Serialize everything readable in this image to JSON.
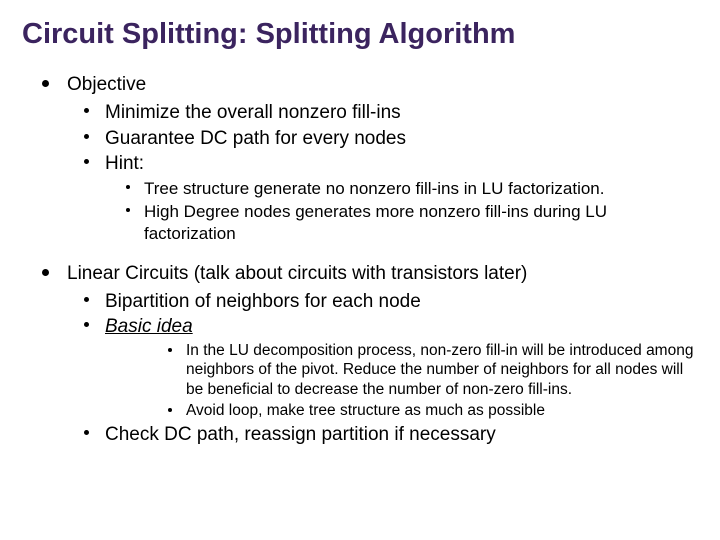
{
  "title": "Circuit Splitting: Splitting Algorithm",
  "s1": {
    "head": "Objective",
    "a": "Minimize the overall nonzero fill-ins",
    "b": "Guarantee DC path for every nodes",
    "c": "Hint:",
    "c1": "Tree structure generate no nonzero fill-ins in LU factorization.",
    "c2": "High Degree nodes generates more nonzero fill-ins during LU factorization"
  },
  "s2": {
    "head": "Linear Circuits (talk about circuits with transistors later)",
    "a": "Bipartition of neighbors for each node",
    "b": "Basic idea",
    "b1": "In the LU decomposition process, non-zero fill-in will be introduced among neighbors of the pivot. Reduce the number of neighbors for all nodes will be beneficial to decrease the number of non-zero fill-ins.",
    "b2": "Avoid loop, make tree structure as much as possible",
    "c": "Check DC path, reassign partition if necessary"
  }
}
